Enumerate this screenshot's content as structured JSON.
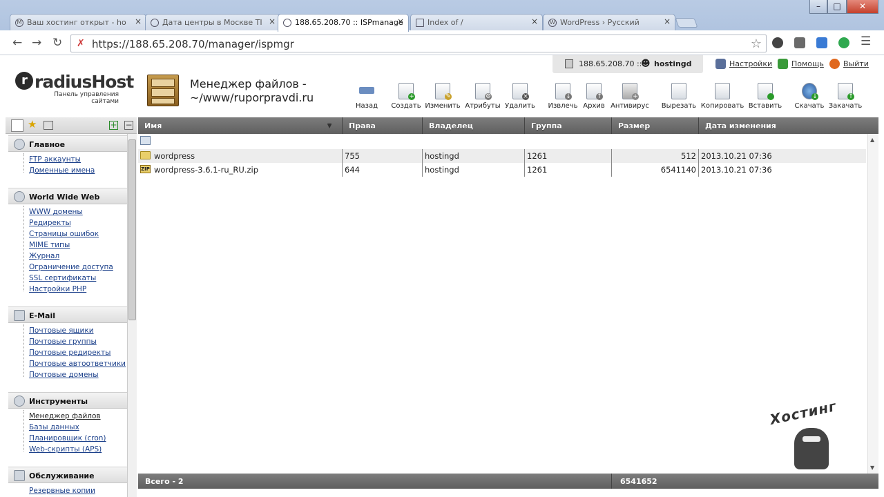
{
  "browser": {
    "tabs": [
      {
        "label": "Ваш хостинг открыт - ho",
        "active": false
      },
      {
        "label": "Дата центры в Москве TI",
        "active": false
      },
      {
        "label": "188.65.208.70 :: ISPmanage",
        "active": true
      },
      {
        "label": "Index of /",
        "active": false
      },
      {
        "label": "WordPress › Русский",
        "active": false
      }
    ],
    "window_buttons": {
      "minimize": "–",
      "maximize": "□",
      "close": "✕"
    },
    "url": "https://188.65.208.70/manager/ispmgr"
  },
  "header": {
    "brand": "radiusHost",
    "brand_sub": "Панель управления сайтами",
    "title_line1": "Менеджер файлов -",
    "title_line2": "~/www/ruporpravdi.ru",
    "server": "188.65.208.70 ::",
    "user": "hostingd",
    "links": {
      "settings": "Настройки",
      "help": "Помощь",
      "logout": "Выйти"
    },
    "toolbar": [
      {
        "id": "back",
        "label": "Назад"
      },
      {
        "id": "create",
        "label": "Создать"
      },
      {
        "id": "edit",
        "label": "Изменить"
      },
      {
        "id": "attrs",
        "label": "Атрибуты"
      },
      {
        "id": "delete",
        "label": "Удалить"
      },
      {
        "id": "extract",
        "label": "Извлечь"
      },
      {
        "id": "archive",
        "label": "Архив"
      },
      {
        "id": "antivirus",
        "label": "Антивирус"
      },
      {
        "id": "cut",
        "label": "Вырезать"
      },
      {
        "id": "copy",
        "label": "Копировать"
      },
      {
        "id": "paste",
        "label": "Вставить"
      },
      {
        "id": "download",
        "label": "Скачать"
      },
      {
        "id": "upload",
        "label": "Закачать"
      }
    ]
  },
  "sidebar": {
    "sections": [
      {
        "title": "Главное",
        "items": [
          "FTP аккаунты",
          "Доменные имена"
        ]
      },
      {
        "title": "World Wide Web",
        "items": [
          "WWW домены",
          "Редиректы",
          "Страницы ошибок",
          "MIME типы",
          "Журнал",
          "Ограничение доступа",
          "SSL сертификаты",
          "Настройки PHP"
        ]
      },
      {
        "title": "E-Mail",
        "items": [
          "Почтовые ящики",
          "Почтовые группы",
          "Почтовые редиректы",
          "Почтовые автоответчики",
          "Почтовые домены"
        ]
      },
      {
        "title": "Инструменты",
        "items": [
          "Менеджер файлов",
          "Базы данных",
          "Планировщик (cron)",
          "Web-скрипты (APS)"
        ]
      },
      {
        "title": "Обслуживание",
        "items": [
          "Резервные копии"
        ]
      }
    ]
  },
  "table": {
    "columns": [
      "Имя",
      "Права",
      "Владелец",
      "Группа",
      "Размер",
      "Дата изменения"
    ],
    "rows": [
      {
        "name": "wordpress",
        "type": "folder",
        "perms": "755",
        "owner": "hostingd",
        "group": "1261",
        "size": "512",
        "date": "2013.10.21 07:36"
      },
      {
        "name": "wordpress-3.6.1-ru_RU.zip",
        "type": "zip",
        "perms": "644",
        "owner": "hostingd",
        "group": "1261",
        "size": "6541140",
        "date": "2013.10.21 07:36"
      }
    ],
    "footer_total": "Всего - 2",
    "footer_size": "6541652"
  },
  "watermark": "Хостинг"
}
